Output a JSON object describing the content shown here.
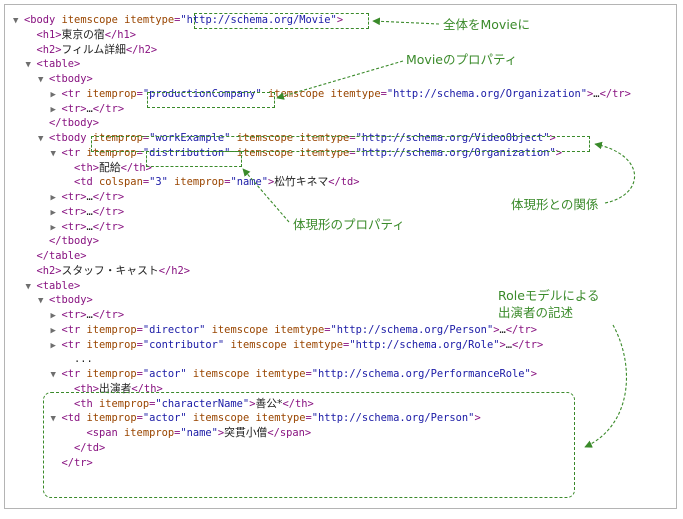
{
  "code_lines": [
    {
      "indent": 0,
      "twisty": "▼",
      "parts": [
        [
          "tag",
          "<body "
        ],
        [
          "attr",
          "itemscope itemtype"
        ],
        [
          "tag",
          "="
        ],
        [
          "val",
          "\"http://schema.org/Movie\""
        ],
        [
          "tag",
          ">"
        ]
      ]
    },
    {
      "indent": 1,
      "twisty": "",
      "parts": [
        [
          "tag",
          "<h1>"
        ],
        [
          "txt",
          "東京の宿"
        ],
        [
          "tag",
          "</h1>"
        ]
      ]
    },
    {
      "indent": 1,
      "twisty": "",
      "parts": [
        [
          "tag",
          "<h2>"
        ],
        [
          "txt",
          "フィルム詳細"
        ],
        [
          "tag",
          "</h2>"
        ]
      ]
    },
    {
      "indent": 1,
      "twisty": "▼",
      "parts": [
        [
          "tag",
          "<table>"
        ]
      ]
    },
    {
      "indent": 2,
      "twisty": "▼",
      "parts": [
        [
          "tag",
          "<tbody>"
        ]
      ]
    },
    {
      "indent": 3,
      "twisty": "▶",
      "parts": [
        [
          "tag",
          "<tr "
        ],
        [
          "attr",
          "itemprop"
        ],
        [
          "tag",
          "="
        ],
        [
          "val",
          "\"productionCompany\""
        ],
        [
          "tag",
          " "
        ],
        [
          "attr",
          "itemscope itemtype"
        ],
        [
          "tag",
          "="
        ],
        [
          "val",
          "\"http://schema.org/Organization\""
        ],
        [
          "tag",
          ">"
        ],
        [
          "dots",
          "…"
        ],
        [
          "tag",
          "</tr>"
        ]
      ]
    },
    {
      "indent": 3,
      "twisty": "▶",
      "parts": [
        [
          "tag",
          "<tr>"
        ],
        [
          "dots",
          "…"
        ],
        [
          "tag",
          "</tr>"
        ]
      ]
    },
    {
      "indent": 2,
      "twisty": "",
      "parts": [
        [
          "tag",
          "</tbody>"
        ]
      ]
    },
    {
      "indent": 2,
      "twisty": "▼",
      "parts": [
        [
          "tag",
          "<tbody "
        ],
        [
          "attr",
          "itemprop"
        ],
        [
          "tag",
          "="
        ],
        [
          "val",
          "\"workExample\""
        ],
        [
          "tag",
          " "
        ],
        [
          "attr",
          "itemscope itemtype"
        ],
        [
          "tag",
          "="
        ],
        [
          "val",
          "\"http://schema.org/VideoObject\""
        ],
        [
          "tag",
          ">"
        ]
      ]
    },
    {
      "indent": 3,
      "twisty": "▼",
      "parts": [
        [
          "tag",
          "<tr "
        ],
        [
          "attr",
          "itemprop"
        ],
        [
          "tag",
          "="
        ],
        [
          "val",
          "\"distribution\""
        ],
        [
          "tag",
          " "
        ],
        [
          "attr",
          "itemscope itemtype"
        ],
        [
          "tag",
          "="
        ],
        [
          "val",
          "\"http://schema.org/Organization\""
        ],
        [
          "tag",
          ">"
        ]
      ]
    },
    {
      "indent": 4,
      "twisty": "",
      "parts": [
        [
          "tag",
          "<th>"
        ],
        [
          "txt",
          "配給"
        ],
        [
          "tag",
          "</th>"
        ]
      ]
    },
    {
      "indent": 4,
      "twisty": "",
      "parts": [
        [
          "tag",
          "<td "
        ],
        [
          "attr",
          "colspan"
        ],
        [
          "tag",
          "="
        ],
        [
          "val",
          "\"3\""
        ],
        [
          "tag",
          " "
        ],
        [
          "attr",
          "itemprop"
        ],
        [
          "tag",
          "="
        ],
        [
          "val",
          "\"name\""
        ],
        [
          "tag",
          ">"
        ],
        [
          "txt",
          "松竹キネマ"
        ],
        [
          "tag",
          "</td>"
        ]
      ]
    },
    {
      "indent": 3,
      "twisty": "▶",
      "parts": [
        [
          "tag",
          "<tr>"
        ],
        [
          "dots",
          "…"
        ],
        [
          "tag",
          "</tr>"
        ]
      ]
    },
    {
      "indent": 3,
      "twisty": "▶",
      "parts": [
        [
          "tag",
          "<tr>"
        ],
        [
          "dots",
          "…"
        ],
        [
          "tag",
          "</tr>"
        ]
      ]
    },
    {
      "indent": 3,
      "twisty": "▶",
      "parts": [
        [
          "tag",
          "<tr>"
        ],
        [
          "dots",
          "…"
        ],
        [
          "tag",
          "</tr>"
        ]
      ]
    },
    {
      "indent": 2,
      "twisty": "",
      "parts": [
        [
          "tag",
          "</tbody>"
        ]
      ]
    },
    {
      "indent": 1,
      "twisty": "",
      "parts": [
        [
          "tag",
          "</table>"
        ]
      ]
    },
    {
      "indent": 1,
      "twisty": "",
      "parts": [
        [
          "tag",
          "<h2>"
        ],
        [
          "txt",
          "スタッフ・キャスト"
        ],
        [
          "tag",
          "</h2>"
        ]
      ]
    },
    {
      "indent": 1,
      "twisty": "▼",
      "parts": [
        [
          "tag",
          "<table>"
        ]
      ]
    },
    {
      "indent": 2,
      "twisty": "▼",
      "parts": [
        [
          "tag",
          "<tbody>"
        ]
      ]
    },
    {
      "indent": 3,
      "twisty": "▶",
      "parts": [
        [
          "tag",
          "<tr>"
        ],
        [
          "dots",
          "…"
        ],
        [
          "tag",
          "</tr>"
        ]
      ]
    },
    {
      "indent": 3,
      "twisty": "▶",
      "parts": [
        [
          "tag",
          "<tr "
        ],
        [
          "attr",
          "itemprop"
        ],
        [
          "tag",
          "="
        ],
        [
          "val",
          "\"director\""
        ],
        [
          "tag",
          " "
        ],
        [
          "attr",
          "itemscope itemtype"
        ],
        [
          "tag",
          "="
        ],
        [
          "val",
          "\"http://schema.org/Person\""
        ],
        [
          "tag",
          ">"
        ],
        [
          "dots",
          "…"
        ],
        [
          "tag",
          "</tr>"
        ]
      ]
    },
    {
      "indent": 3,
      "twisty": "▶",
      "parts": [
        [
          "tag",
          "<tr "
        ],
        [
          "attr",
          "itemprop"
        ],
        [
          "tag",
          "="
        ],
        [
          "val",
          "\"contributor\""
        ],
        [
          "tag",
          " "
        ],
        [
          "attr",
          "itemscope itemtype"
        ],
        [
          "tag",
          "="
        ],
        [
          "val",
          "\"http://schema.org/Role\""
        ],
        [
          "tag",
          ">"
        ],
        [
          "dots",
          "…"
        ],
        [
          "tag",
          "</tr>"
        ]
      ]
    },
    {
      "indent": 4,
      "twisty": "",
      "parts": [
        [
          "dots",
          "..."
        ]
      ]
    },
    {
      "indent": 3,
      "twisty": "▼",
      "parts": [
        [
          "tag",
          "<tr "
        ],
        [
          "attr",
          "itemprop"
        ],
        [
          "tag",
          "="
        ],
        [
          "val",
          "\"actor\""
        ],
        [
          "tag",
          " "
        ],
        [
          "attr",
          "itemscope itemtype"
        ],
        [
          "tag",
          "="
        ],
        [
          "val",
          "\"http://schema.org/PerformanceRole\""
        ],
        [
          "tag",
          ">"
        ]
      ]
    },
    {
      "indent": 4,
      "twisty": "",
      "parts": [
        [
          "tag",
          "<th>"
        ],
        [
          "txt",
          "出演者"
        ],
        [
          "tag",
          "</th>"
        ]
      ]
    },
    {
      "indent": 4,
      "twisty": "",
      "parts": [
        [
          "tag",
          "<th "
        ],
        [
          "attr",
          "itemprop"
        ],
        [
          "tag",
          "="
        ],
        [
          "val",
          "\"characterName\""
        ],
        [
          "tag",
          ">"
        ],
        [
          "txt",
          "善公*"
        ],
        [
          "tag",
          "</th>"
        ]
      ]
    },
    {
      "indent": 3,
      "twisty": "▼",
      "parts": [
        [
          "tag",
          "<td "
        ],
        [
          "attr",
          "itemprop"
        ],
        [
          "tag",
          "="
        ],
        [
          "val",
          "\"actor\""
        ],
        [
          "tag",
          " "
        ],
        [
          "attr",
          "itemscope itemtype"
        ],
        [
          "tag",
          "="
        ],
        [
          "val",
          "\"http://schema.org/Person\""
        ],
        [
          "tag",
          ">"
        ]
      ]
    },
    {
      "indent": 5,
      "twisty": "",
      "parts": [
        [
          "tag",
          "<span "
        ],
        [
          "attr",
          "itemprop"
        ],
        [
          "tag",
          "="
        ],
        [
          "val",
          "\"name\""
        ],
        [
          "tag",
          ">"
        ],
        [
          "txt",
          "突貫小僧"
        ],
        [
          "tag",
          "</span>"
        ]
      ]
    },
    {
      "indent": 4,
      "twisty": "",
      "parts": [
        [
          "tag",
          "</td>"
        ]
      ]
    },
    {
      "indent": 3,
      "twisty": "",
      "parts": [
        [
          "tag",
          "</tr>"
        ]
      ]
    }
  ],
  "annotations": {
    "movie_whole": "全体をMovieに",
    "movie_props": "Movieのプロパティ",
    "work_relation": "体現形との関係",
    "work_props": "体現形のプロパティ",
    "role_model": "Roleモデルによる\n出演者の記述"
  },
  "colors": {
    "annotation": "#3a8a2a",
    "tag": "#881280",
    "attr": "#994500",
    "value": "#1a1aa6"
  }
}
